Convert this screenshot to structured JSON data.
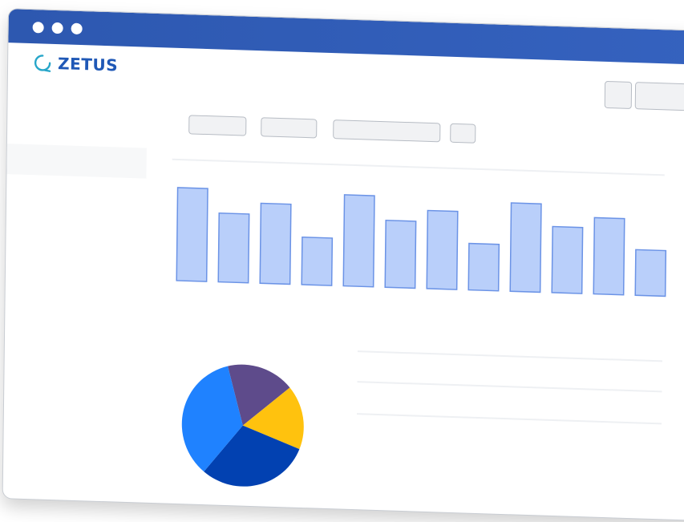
{
  "window": {
    "controls": [
      "close-dot",
      "minimize-dot",
      "maximize-dot"
    ],
    "accent_color": "#2d58b0"
  },
  "brand": {
    "logo_text": "ZETUS",
    "logo_color": "#1f58b6",
    "logo_accent": "#27a6c9"
  },
  "toolbar": {
    "buttons": [
      "blank-button",
      "blank-button"
    ]
  },
  "filters": [
    "blank-filter",
    "blank-filter",
    "blank-filter",
    "blank-filter"
  ],
  "chart_data": [
    {
      "type": "bar",
      "values": [
        100,
        74,
        86,
        51,
        98,
        72,
        84,
        50,
        95,
        71,
        82,
        49
      ],
      "ylim": [
        0,
        100
      ],
      "bar_color": "#b9cffa",
      "bar_stroke": "#6b93e6"
    },
    {
      "type": "pie",
      "values": [
        18,
        17,
        30,
        35
      ],
      "colors": [
        "#5e4b8b",
        "#ffc20e",
        "#0241b1",
        "#1f82ff"
      ]
    }
  ]
}
